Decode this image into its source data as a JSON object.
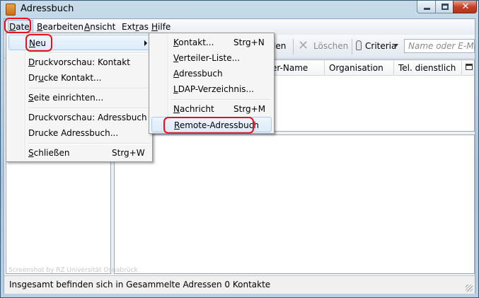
{
  "window": {
    "title": "Adressbuch",
    "min_icon": "minimize-icon",
    "max_icon": "maximize-icon",
    "close_icon": "close-icon",
    "close_glyph": "✕"
  },
  "menubar": [
    {
      "pre": "",
      "acc": "D",
      "post": "atei"
    },
    {
      "pre": "",
      "acc": "B",
      "post": "earbeiten"
    },
    {
      "pre": "",
      "acc": "A",
      "post": "nsicht"
    },
    {
      "pre": "Ext",
      "acc": "r",
      "post": "as"
    },
    {
      "pre": "",
      "acc": "H",
      "post": "ilfe"
    }
  ],
  "toolbar": {
    "edit_fragment": "len",
    "delete_label": "Löschen",
    "delete_icon": "x-icon",
    "criteria_label": "Criteria",
    "criteria_icon": "key-icon",
    "search_placeholder": "Name oder E-Mail"
  },
  "columns": {
    "name_fragment": "er-Name",
    "organisation": "Organisation",
    "phone": "Tel. dienstlich",
    "picker_icon": "column-picker-icon"
  },
  "file_menu": {
    "new_pre": "",
    "new_acc": "N",
    "new_post": "eu",
    "print_preview_contact": {
      "pre": "",
      "acc": "D",
      "post": "ruckvorschau: Kontakt"
    },
    "print_contact": {
      "pre": "Dr",
      "acc": "u",
      "post": "cke Kontakt..."
    },
    "page_setup": {
      "pre": "",
      "acc": "S",
      "post": "eite einrichten..."
    },
    "print_preview_book": {
      "pre": "Druckvorschau: Adressbuch"
    },
    "print_book": {
      "pre": "Drucke Adressbuch..."
    },
    "close": {
      "pre": "",
      "acc": "S",
      "post": "chließen",
      "shortcut": "Strg+W"
    }
  },
  "new_submenu": {
    "contact": {
      "acc": "K",
      "post": "ontakt...",
      "shortcut": "Strg+N"
    },
    "list": {
      "acc": "V",
      "post": "erteiler-Liste..."
    },
    "addressbook": {
      "acc": "A",
      "post": "dressbuch"
    },
    "ldap": {
      "acc": "L",
      "post": "DAP-Verzeichnis..."
    },
    "message": {
      "acc": "N",
      "post": "achricht",
      "shortcut": "Strg+M"
    },
    "remote": {
      "acc": "R",
      "post": "emote-Adressbuch"
    }
  },
  "watermark": "Screenshot by RZ Universität Osnabrück",
  "status": "Insgesamt befinden sich in Gesammelte Adressen 0 Kontakte",
  "colors": {
    "highlight_border": "#e8101b",
    "menu_highlight": "#dcebfb"
  }
}
